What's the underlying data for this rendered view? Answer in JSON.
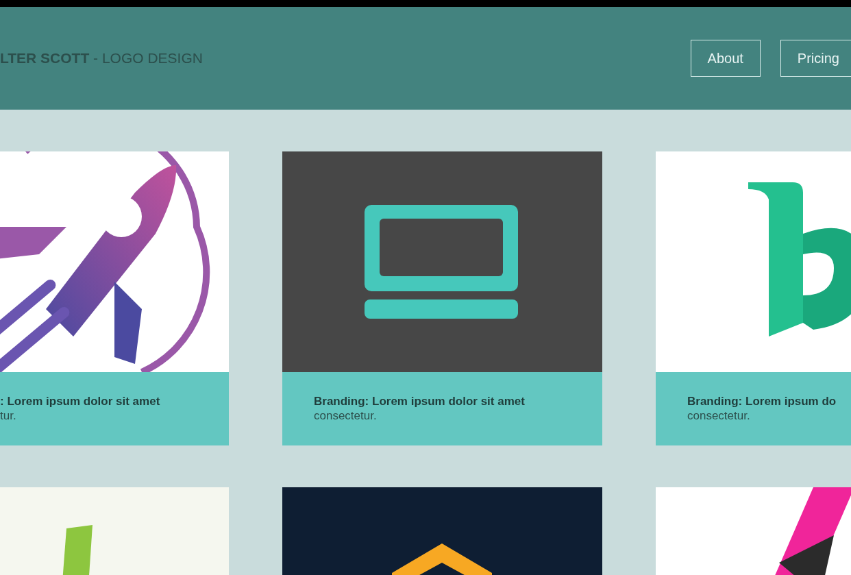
{
  "header": {
    "title": "**LTER SCOTT** - LOGO DESIGN",
    "nav": [
      {
        "label": "About"
      },
      {
        "label": "Pricing"
      }
    ]
  },
  "cards": [
    {
      "kind": "picture",
      "title": ": Lorem ipsum dolor sit amet",
      "subtitle": "tur."
    },
    {
      "kind": "picture",
      "title": "Branding: Lorem ipsum dolor sit amet",
      "subtitle": "consectetur."
    },
    {
      "kind": "picture",
      "title": "Branding: Lorem ipsum do",
      "subtitle": "consectetur."
    },
    {
      "kind": "picture"
    },
    {
      "kind": "picture"
    },
    {
      "kind": "picture"
    }
  ]
}
